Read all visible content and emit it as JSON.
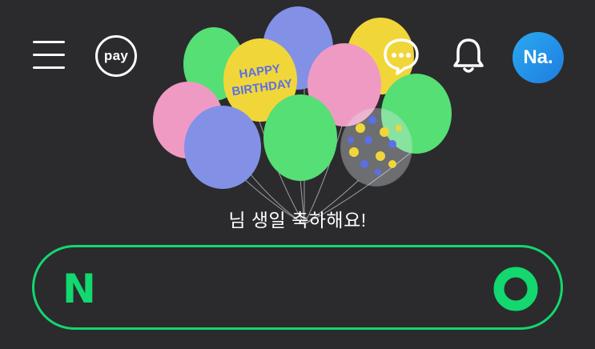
{
  "header": {
    "menu_icon": "hamburger-menu-icon",
    "pay_label": "pay",
    "chat_icon": "chat-bubble-icon",
    "bell_icon": "notification-bell-icon",
    "avatar_label": "Na."
  },
  "banner": {
    "balloon_text": "HAPPY BIRTHDAY",
    "message": "님 생일 축하해요!"
  },
  "search": {
    "logo": "N",
    "placeholder": "",
    "search_icon": "green-o-search-icon"
  },
  "colors": {
    "background": "#2b2b2d",
    "accent": "#12d86f",
    "avatar": "#1e8fe6"
  }
}
